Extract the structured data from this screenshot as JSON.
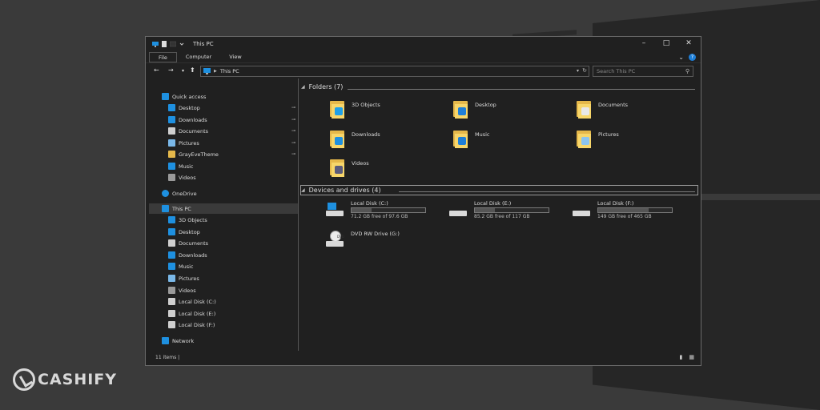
{
  "window": {
    "title": "This PC",
    "controls": {
      "minimize": "–",
      "maximize": "□",
      "close": "✕"
    }
  },
  "ribbon": {
    "tabs": [
      {
        "label": "File"
      },
      {
        "label": "Computer"
      },
      {
        "label": "View"
      }
    ],
    "help_label": "?",
    "collapse_label": "⌄"
  },
  "nav": {
    "back": "←",
    "forward": "→",
    "recent": "▾",
    "up": "⬆",
    "address": "This PC",
    "search_placeholder": "Search This PC"
  },
  "sidebar": {
    "items": [
      {
        "label": "Quick access",
        "icon": "star-icon",
        "color": "#1e90e0",
        "pinned": false,
        "selected": false
      },
      {
        "label": "Desktop",
        "icon": "desktop-icon",
        "color": "#1e90e0",
        "pinned": true,
        "selected": false
      },
      {
        "label": "Downloads",
        "icon": "download-icon",
        "color": "#1e90e0",
        "pinned": true,
        "selected": false
      },
      {
        "label": "Documents",
        "icon": "document-icon",
        "color": "#cfcfcf",
        "pinned": true,
        "selected": false
      },
      {
        "label": "Pictures",
        "icon": "picture-icon",
        "color": "#7ab8e8",
        "pinned": true,
        "selected": false
      },
      {
        "label": "GrayEveTheme",
        "icon": "folder-icon",
        "color": "#e5b84a",
        "pinned": true,
        "selected": false
      },
      {
        "label": "Music",
        "icon": "music-icon",
        "color": "#1e90e0",
        "pinned": false,
        "selected": false
      },
      {
        "label": "Videos",
        "icon": "video-icon",
        "color": "#9a9a9a",
        "pinned": false,
        "selected": false
      },
      {
        "label": "OneDrive",
        "icon": "cloud-icon",
        "color": "#1e90e0",
        "pinned": false,
        "selected": false
      },
      {
        "label": "This PC",
        "icon": "computer-icon",
        "color": "#1e90e0",
        "pinned": false,
        "selected": true
      },
      {
        "label": "3D Objects",
        "icon": "cube-icon",
        "color": "#1e90e0",
        "pinned": false,
        "selected": false
      },
      {
        "label": "Desktop",
        "icon": "desktop-icon",
        "color": "#1e90e0",
        "pinned": false,
        "selected": false
      },
      {
        "label": "Documents",
        "icon": "document-icon",
        "color": "#cfcfcf",
        "pinned": false,
        "selected": false
      },
      {
        "label": "Downloads",
        "icon": "download-icon",
        "color": "#1e90e0",
        "pinned": false,
        "selected": false
      },
      {
        "label": "Music",
        "icon": "music-icon",
        "color": "#1e90e0",
        "pinned": false,
        "selected": false
      },
      {
        "label": "Pictures",
        "icon": "picture-icon",
        "color": "#7ab8e8",
        "pinned": false,
        "selected": false
      },
      {
        "label": "Videos",
        "icon": "video-icon",
        "color": "#9a9a9a",
        "pinned": false,
        "selected": false
      },
      {
        "label": "Local Disk (C:)",
        "icon": "drive-icon",
        "color": "#cfcfcf",
        "pinned": false,
        "selected": false
      },
      {
        "label": "Local Disk (E:)",
        "icon": "drive-icon",
        "color": "#cfcfcf",
        "pinned": false,
        "selected": false
      },
      {
        "label": "Local Disk (F:)",
        "icon": "drive-icon",
        "color": "#cfcfcf",
        "pinned": false,
        "selected": false
      },
      {
        "label": "Network",
        "icon": "network-icon",
        "color": "#1e90e0",
        "pinned": false,
        "selected": false
      }
    ]
  },
  "folders": {
    "header": "Folders (7)",
    "items": [
      {
        "label": "3D Objects",
        "icon": "3d-objects-folder-icon",
        "badge": "#1ea0e8"
      },
      {
        "label": "Desktop",
        "icon": "desktop-folder-icon",
        "badge": "#1e7fd8"
      },
      {
        "label": "Documents",
        "icon": "documents-folder-icon",
        "badge": "#e8e8e8"
      },
      {
        "label": "Downloads",
        "icon": "downloads-folder-icon",
        "badge": "#1e90e0"
      },
      {
        "label": "Music",
        "icon": "music-folder-icon",
        "badge": "#1e7fd8"
      },
      {
        "label": "Pictures",
        "icon": "pictures-folder-icon",
        "badge": "#8cc4ee"
      },
      {
        "label": "Videos",
        "icon": "videos-folder-icon",
        "badge": "#5a5a7a"
      }
    ]
  },
  "drives": {
    "header": "Devices and drives (4)",
    "items": [
      {
        "name": "Local Disk (C:)",
        "free_text": "71.2 GB free of 97.6 GB",
        "used_fraction": 0.27,
        "icon": "system-drive-icon"
      },
      {
        "name": "Local Disk (E:)",
        "free_text": "85.2 GB free of 117 GB",
        "used_fraction": 0.27,
        "icon": "drive-icon"
      },
      {
        "name": "Local Disk (F:)",
        "free_text": "149 GB free of 465 GB",
        "used_fraction": 0.68,
        "icon": "drive-icon"
      },
      {
        "name": "DVD RW Drive (G:)",
        "free_text": "",
        "used_fraction": null,
        "icon": "dvd-drive-icon",
        "disc_label": "DVD"
      }
    ]
  },
  "status": {
    "items_text": "11 items"
  },
  "brand": {
    "name": "CASHIFY",
    "color": "#d8d8d8"
  }
}
